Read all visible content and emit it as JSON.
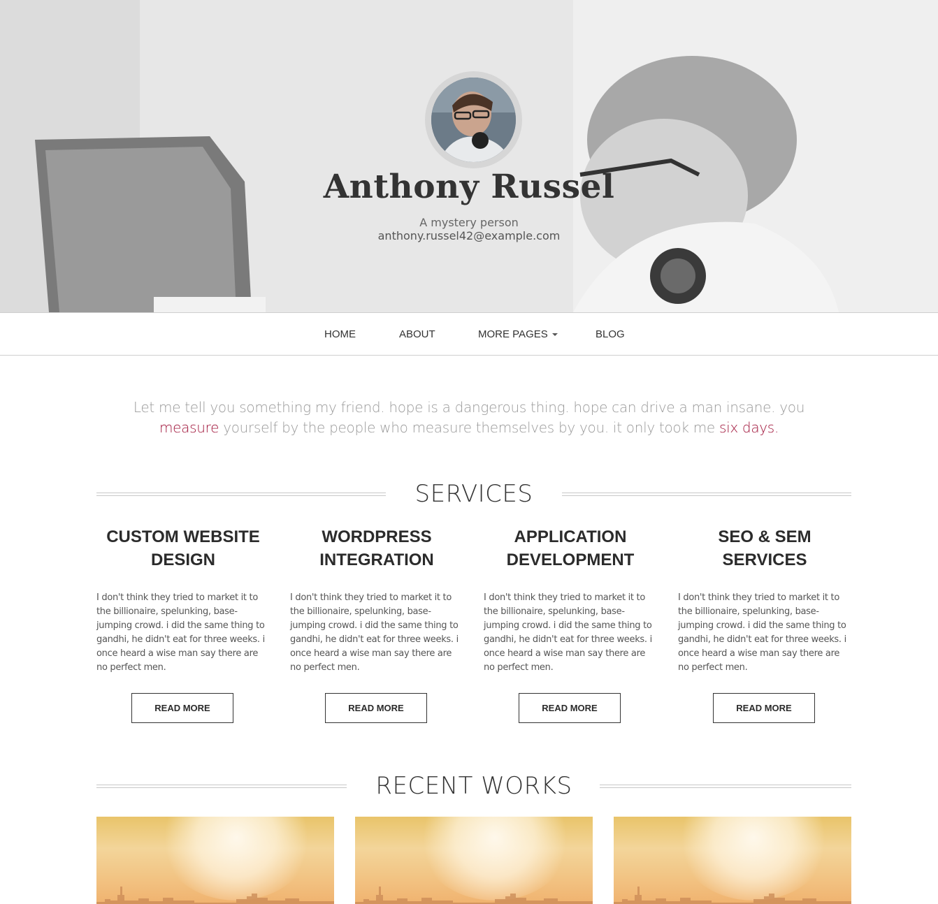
{
  "hero": {
    "name": "Anthony Russel",
    "tagline": "A mystery person",
    "email": "anthony.russel42@example.com"
  },
  "nav": {
    "items": [
      {
        "label": "HOME"
      },
      {
        "label": "ABOUT"
      },
      {
        "label": "MORE PAGES",
        "has_dropdown": true
      },
      {
        "label": "BLOG"
      }
    ]
  },
  "intro": {
    "part1": "Let me tell you something my friend. hope is a dangerous thing. hope can drive a man insane. you ",
    "link1": "measure",
    "part2": " yourself by the people who measure themselves by you. it only took me ",
    "link2": "six days",
    "part3": ".",
    "accent_color": "#a0143a"
  },
  "services": {
    "heading": "SERVICES",
    "items": [
      {
        "title_line1": "CUSTOM WEBSITE",
        "title_line2": "DESIGN",
        "text": "I don't think they tried to market it to the billionaire, spelunking, base-jumping crowd. i did the same thing to gandhi, he didn't eat for three weeks. i once heard a wise man say there are no perfect men.",
        "button": "READ MORE"
      },
      {
        "title_line1": "WORDPRESS",
        "title_line2": "INTEGRATION",
        "text": "I don't think they tried to market it to the billionaire, spelunking, base-jumping crowd. i did the same thing to gandhi, he didn't eat for three weeks. i once heard a wise man say there are no perfect men.",
        "button": "READ MORE"
      },
      {
        "title_line1": "APPLICATION",
        "title_line2": "DEVELOPMENT",
        "text": "I don't think they tried to market it to the billionaire, spelunking, base-jumping crowd. i did the same thing to gandhi, he didn't eat for three weeks. i once heard a wise man say there are no perfect men.",
        "button": "READ MORE"
      },
      {
        "title_line1": "SEO & SEM",
        "title_line2": "SERVICES",
        "text": "I don't think they tried to market it to the billionaire, spelunking, base-jumping crowd. i did the same thing to gandhi, he didn't eat for three weeks. i once heard a wise man say there are no perfect men.",
        "button": "READ MORE"
      }
    ]
  },
  "works": {
    "heading": "RECENT WORKS"
  }
}
